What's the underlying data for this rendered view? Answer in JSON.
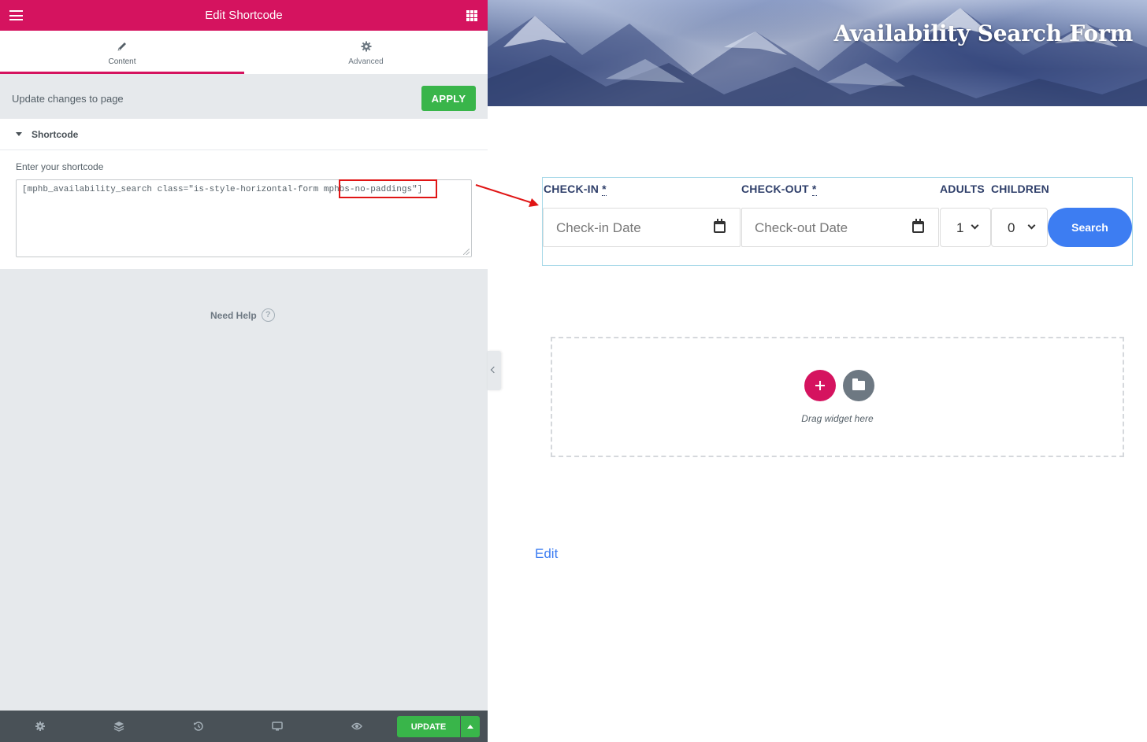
{
  "panel": {
    "header_title": "Edit Shortcode",
    "tabs": [
      {
        "label": "Content",
        "icon": "pencil-icon",
        "active": true
      },
      {
        "label": "Advanced",
        "icon": "gear-icon",
        "active": false
      }
    ],
    "apply_row": {
      "label": "Update changes to page",
      "button": "APPLY"
    },
    "section": {
      "title": "Shortcode",
      "field_label": "Enter your shortcode",
      "shortcode_value": "[mphb_availability_search class=\"is-style-horizontal-form mphbs-no-paddings\"]"
    },
    "need_help": "Need Help",
    "footer": {
      "icons": [
        "settings-icon",
        "layers-icon",
        "history-icon",
        "responsive-icon",
        "preview-eye-icon"
      ],
      "update_button": "UPDATE"
    }
  },
  "preview": {
    "hero_title": "Availability Search Form",
    "form": {
      "checkin_label": "CHECK-IN",
      "checkout_label": "CHECK-OUT",
      "required_mark": "*",
      "adults_label": "ADULTS",
      "children_label": "CHILDREN",
      "checkin_placeholder": "Check-in Date",
      "checkout_placeholder": "Check-out Date",
      "adults_value": "1",
      "children_value": "0",
      "search_button": "Search"
    },
    "dropzone_text": "Drag widget here",
    "edit_link": "Edit"
  },
  "colors": {
    "brand": "#d5135f",
    "apply_green": "#39b54a",
    "search_blue": "#3d7df2",
    "highlight_red": "#e01515"
  }
}
